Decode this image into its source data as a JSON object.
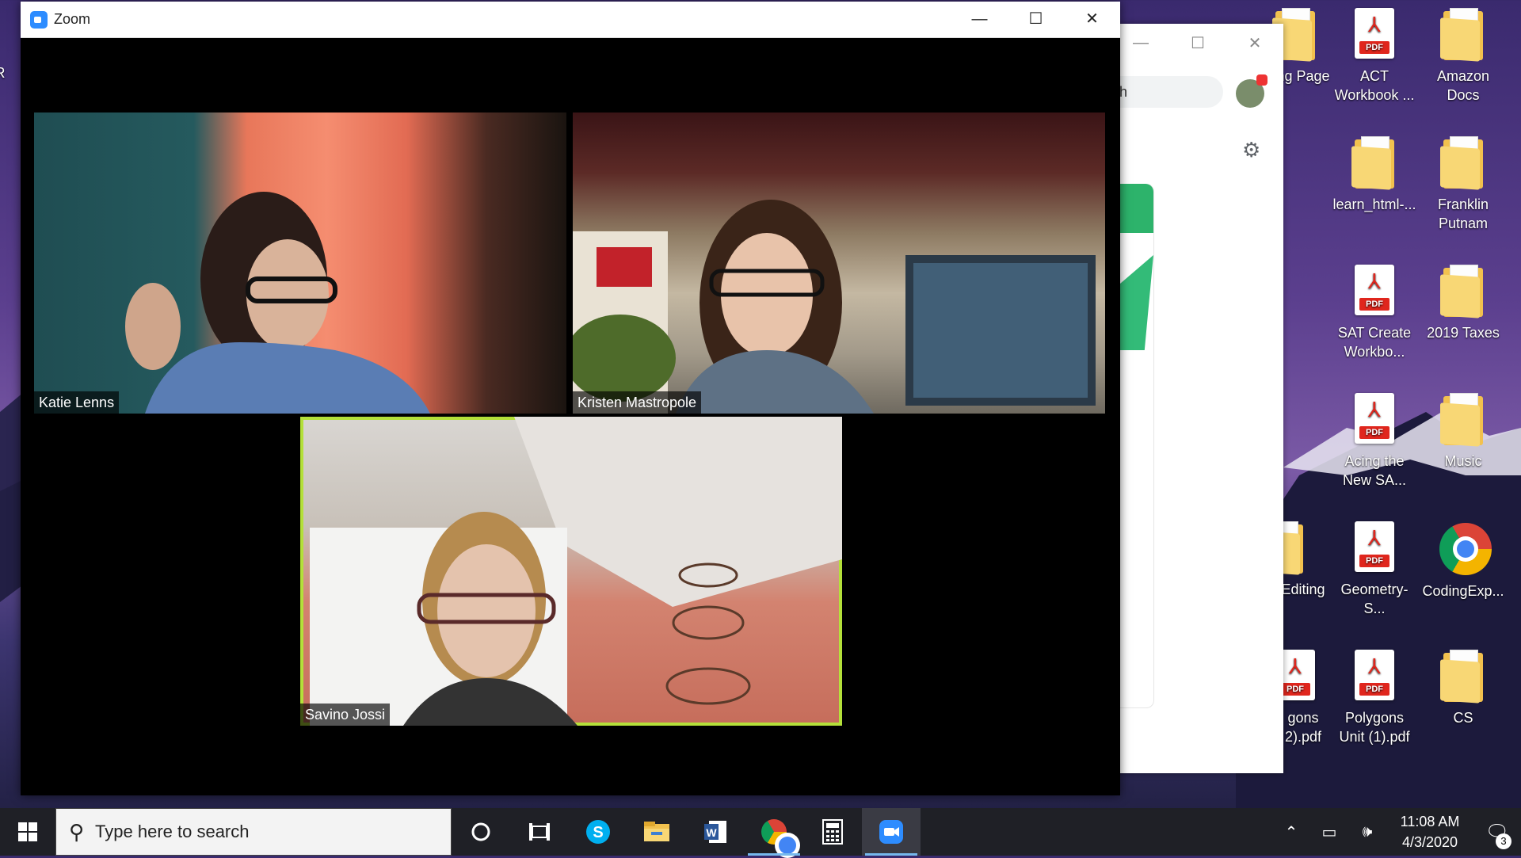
{
  "zoom": {
    "title": "Zoom",
    "participants": [
      {
        "name": "Katie Lenns",
        "active": false
      },
      {
        "name": "Kristen Mastropole",
        "active": false
      },
      {
        "name": "Savino Jossi",
        "active": true
      }
    ]
  },
  "browser": {
    "search_fragment": "ch"
  },
  "desktop_icons": [
    {
      "label": "ng Page",
      "type": "pdf-partial"
    },
    {
      "label": "ACT Workbook ...",
      "type": "pdf"
    },
    {
      "label": "Amazon Docs",
      "type": "folder"
    },
    {
      "label": "learn_html-...",
      "type": "folder"
    },
    {
      "label": "Franklin Putnam",
      "type": "folder-pdf"
    },
    {
      "label": "SAT Create Workbo...",
      "type": "pdf"
    },
    {
      "label": "2019 Taxes",
      "type": "folder-pdf"
    },
    {
      "label": "Acing the New SA...",
      "type": "pdf"
    },
    {
      "label": "Music",
      "type": "folder"
    },
    {
      "label": "Editing",
      "type": "folder-partial"
    },
    {
      "label": "Geometry-S...",
      "type": "pdf"
    },
    {
      "label": "CodingExp...",
      "type": "chrome"
    },
    {
      "label": "gons 2).pdf",
      "type": "pdf-partial"
    },
    {
      "label": "Polygons Unit (1).pdf",
      "type": "pdf"
    },
    {
      "label": "CS",
      "type": "folder"
    }
  ],
  "taskbar": {
    "search_placeholder": "Type here to search",
    "apps": [
      "cortana",
      "task-view",
      "skype",
      "file-explorer",
      "word",
      "chrome",
      "calculator",
      "zoom"
    ],
    "time": "11:08 AM",
    "date": "4/3/2020",
    "notification_count": "3"
  },
  "colors": {
    "active_speaker_border": "#b4e03a",
    "zoom_blue": "#2d8cff",
    "taskbar": "#1f2026"
  }
}
